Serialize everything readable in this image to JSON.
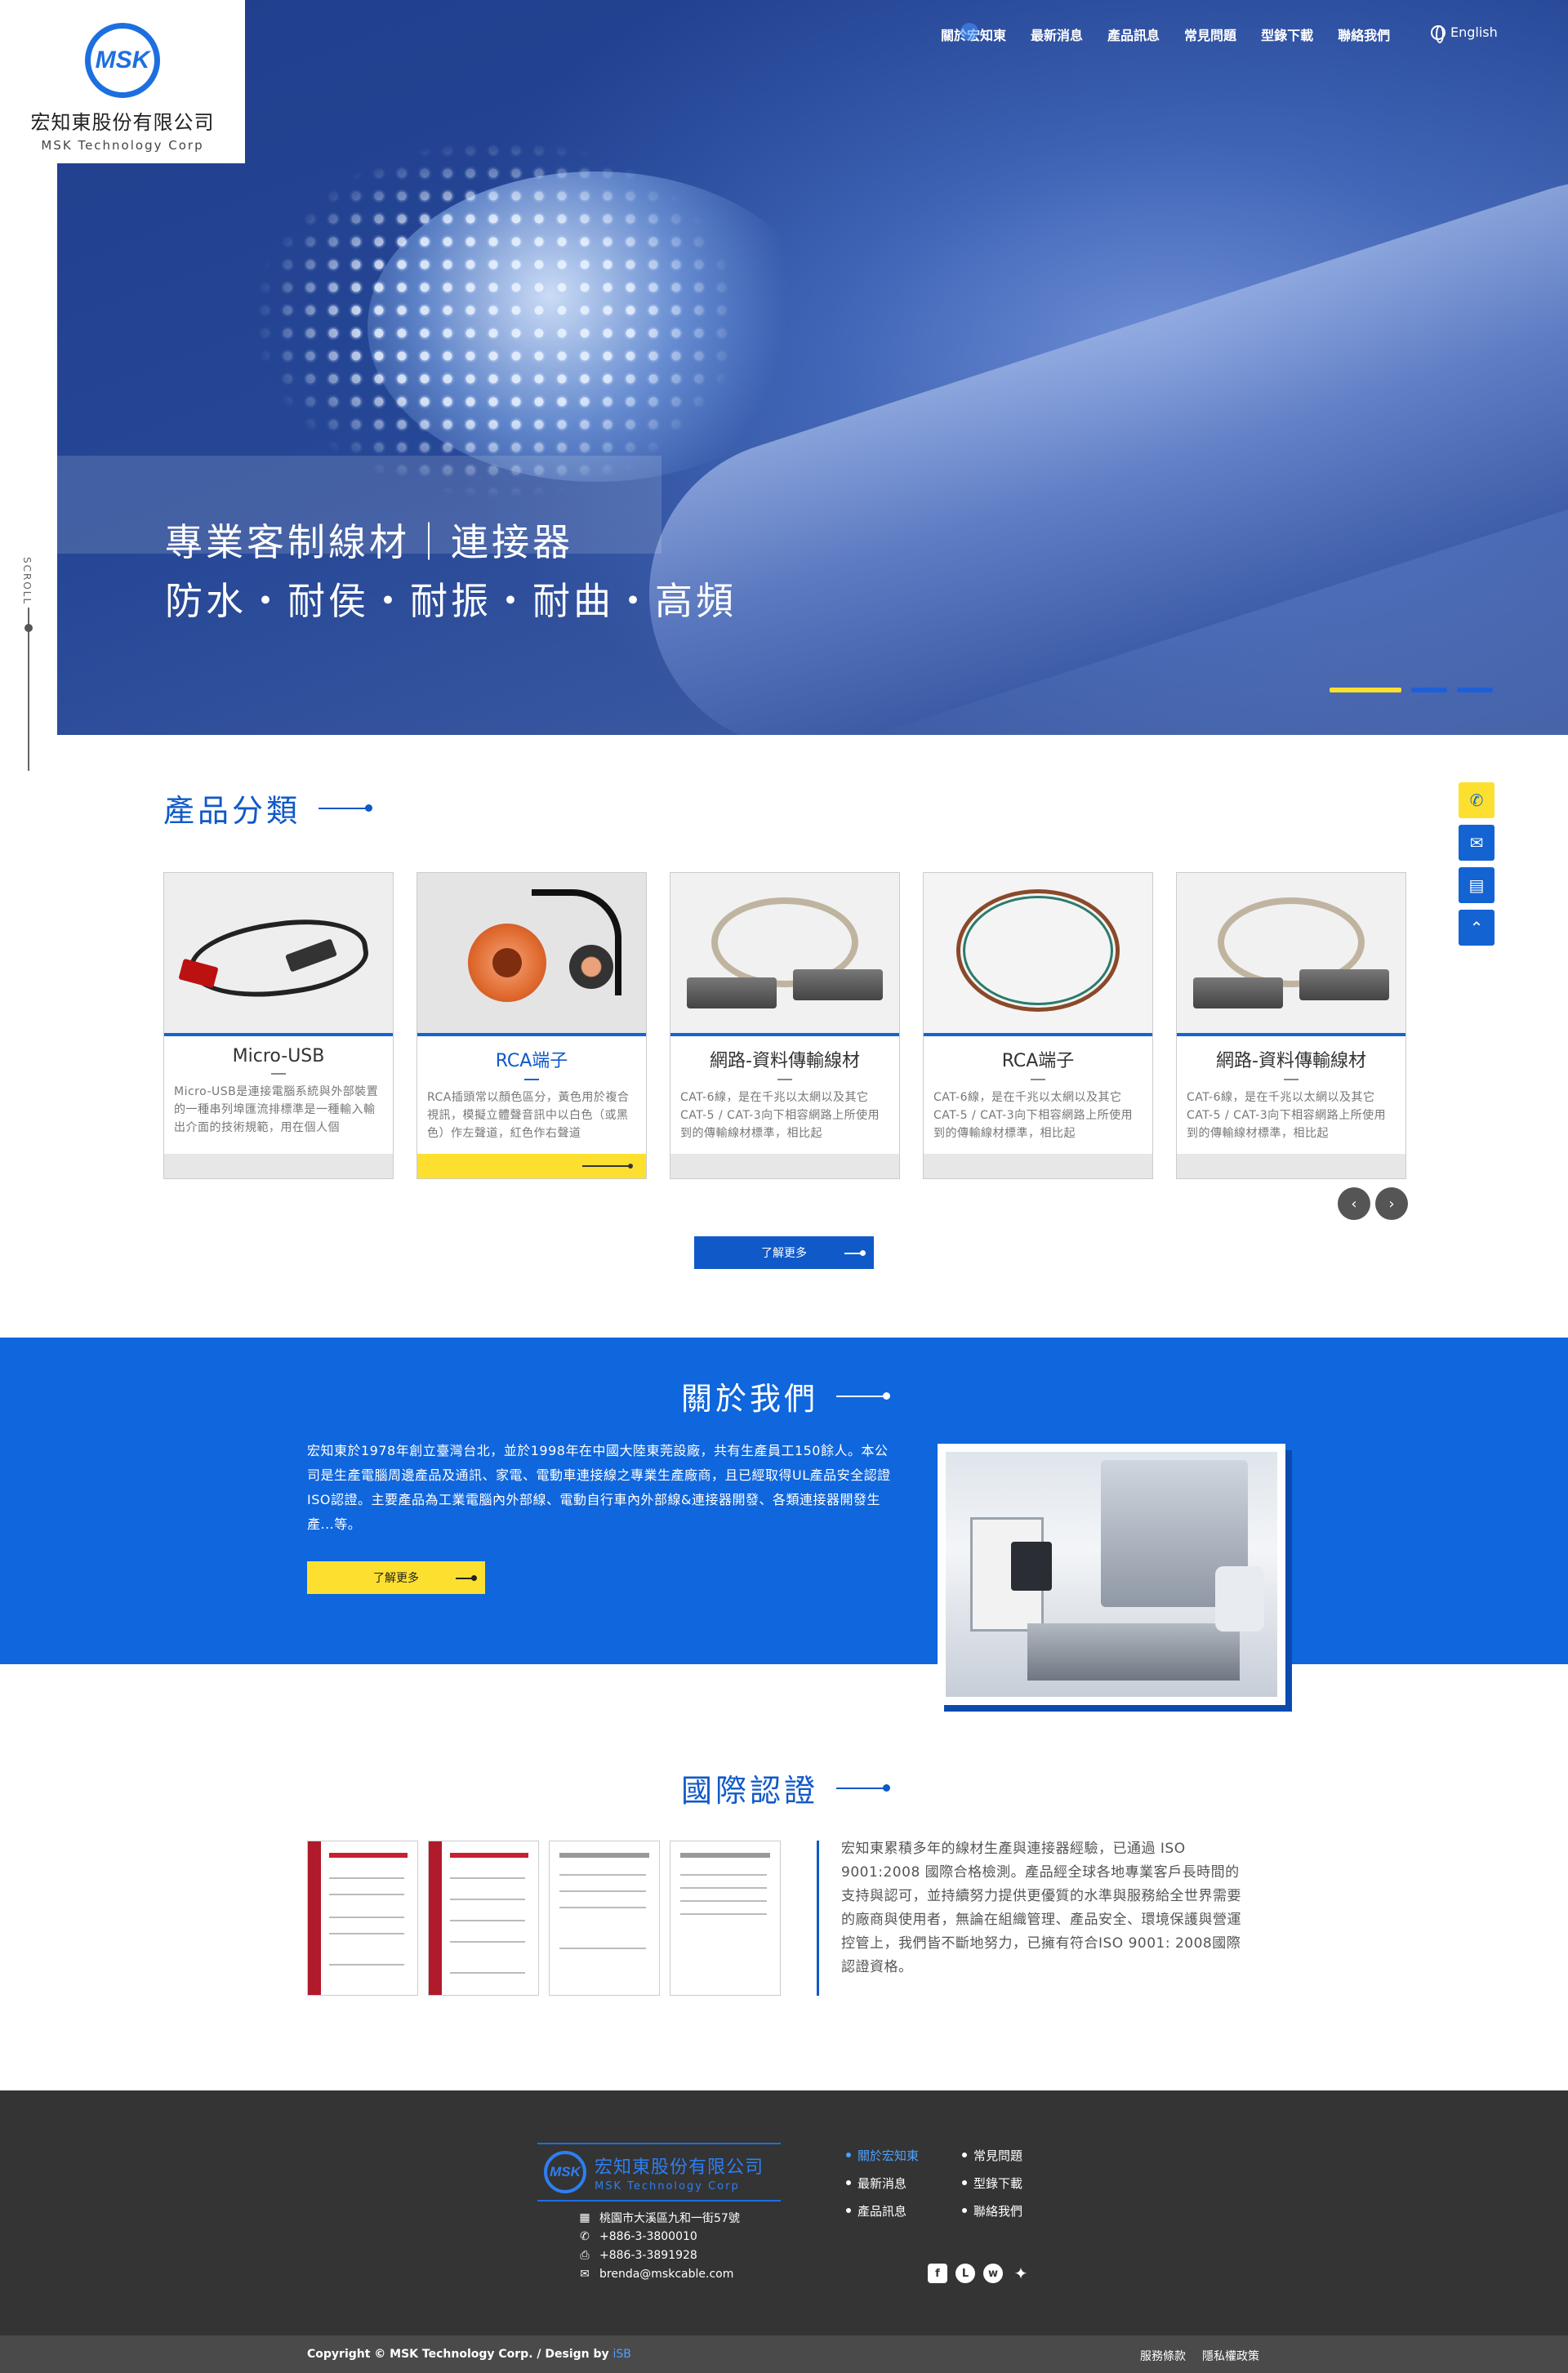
{
  "brand": {
    "logo_mark": "MSK",
    "name_cn": "宏知東股份有限公司",
    "name_en": "MSK Technology Corp",
    "accent": "#1059c9",
    "yellow": "#fde02f"
  },
  "nav": {
    "items": [
      "關於宏知東",
      "最新消息",
      "產品訊息",
      "常見問題",
      "型錄下載",
      "聯絡我們"
    ],
    "active": 0,
    "lang": "English"
  },
  "hero": {
    "line1": "專業客制線材｜連接器",
    "line2": "防水・耐侯・耐振・耐曲・高頻",
    "slides": 3,
    "active_slide": 0
  },
  "scroll_label": "SCROLL",
  "side_tools": {
    "icons": [
      "phone-icon",
      "mail-icon",
      "document-icon",
      "arrow-up-icon"
    ]
  },
  "products": {
    "title": "產品分類",
    "cards": [
      {
        "name": "Micro-USB",
        "desc": "Micro-USB是連接電腦系統與外部裝置的一種串列埠匯流排標準是一種輸入輸出介面的技術規範，用在個人個"
      },
      {
        "name": "RCA端子",
        "desc": "RCA插頭常以顏色區分，黃色用於複合視訊，模擬立體聲音訊中以白色（或黑色）作左聲道，紅色作右聲道"
      },
      {
        "name": "網路-資料傳輸線材",
        "desc": "CAT-6線，是在千兆以太網以及其它CAT-5 / CAT-3向下相容網路上所使用到的傳輸線材標準，相比起"
      },
      {
        "name": "RCA端子",
        "desc": "CAT-6線，是在千兆以太網以及其它CAT-5 / CAT-3向下相容網路上所使用到的傳輸線材標準，相比起"
      },
      {
        "name": "網路-資料傳輸線材",
        "desc": "CAT-6線，是在千兆以太網以及其它CAT-5 / CAT-3向下相容網路上所使用到的傳輸線材標準，相比起"
      }
    ],
    "active_card": 1,
    "prev": "‹",
    "next": "›",
    "more": "了解更多"
  },
  "about": {
    "title": "關於我們",
    "text": "宏知東於1978年創立臺灣台北，並於1998年在中國大陸東莞設廠，共有生產員工150餘人。本公司是生產電腦周邊產品及通訊、家電、電動車連接線之專業生產廠商，且已經取得UL產品安全認證ISO認證。主要產品為工業電腦內外部線、電動自行車內外部線&連接器開發、各類連接器開發生產...等。",
    "more": "了解更多"
  },
  "cert": {
    "title": "國際認證",
    "text": "宏知東累積多年的線材生產與連接器經驗，已通過 ISO 9001:2008 國際合格檢測。產品經全球各地專業客戶長時間的支持與認可，並持續努力提供更優質的水準與服務給全世界需要的廠商與使用者，無論在組織管理、產品安全、環境保護與營運控管上，我們皆不斷地努力，已擁有符合ISO 9001: 2008國際認證資格。",
    "count": 4
  },
  "footer": {
    "address": "桃園市大溪區九和一街57號",
    "phone": "+886-3-3800010",
    "fax": "+886-3-3891928",
    "email": "brenda@mskcable.com",
    "nav": [
      "關於宏知東",
      "常見問題",
      "最新消息",
      "型錄下載",
      "產品訊息",
      "聯絡我們"
    ],
    "social": [
      "facebook-icon",
      "line-icon",
      "wechat-icon",
      "twitter-icon"
    ],
    "copyright": "Copyright © MSK Technology Corp. / Design by",
    "designer": "iSB",
    "links": [
      "服務條款",
      "隱私權政策"
    ]
  }
}
